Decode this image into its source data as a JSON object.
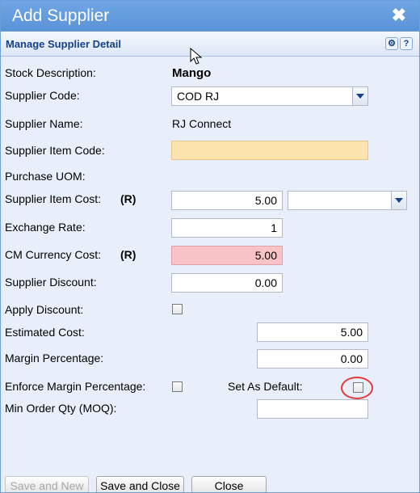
{
  "window": {
    "title": "Add Supplier",
    "close_glyph": "✖"
  },
  "panel": {
    "title": "Manage Supplier Detail",
    "tools": [
      "gear-icon",
      "help-icon"
    ],
    "help_glyph": "?",
    "gear_glyph": "⚙"
  },
  "form": {
    "stock_description": {
      "label": "Stock Description:",
      "value": "Mango"
    },
    "supplier_code": {
      "label": "Supplier Code:",
      "value": "COD RJ"
    },
    "supplier_name": {
      "label": "Supplier Name:",
      "value": "RJ Connect"
    },
    "supplier_item_code": {
      "label": "Supplier Item Code:",
      "value": ""
    },
    "purchase_uom": {
      "label": "Purchase UOM:"
    },
    "supplier_item_cost": {
      "label": "Supplier Item Cost:",
      "marker": "(R)",
      "value": "5.00",
      "currency": ""
    },
    "exchange_rate": {
      "label": "Exchange Rate:",
      "value": "1"
    },
    "cm_currency_cost": {
      "label": "CM Currency Cost:",
      "marker": "(R)",
      "value": "5.00"
    },
    "supplier_discount": {
      "label": "Supplier Discount:",
      "value": "0.00"
    },
    "apply_discount": {
      "label": "Apply Discount:",
      "checked": false
    },
    "estimated_cost": {
      "label": "Estimated Cost:",
      "value": "5.00"
    },
    "margin_percentage": {
      "label": "Margin Percentage:",
      "value": "0.00"
    },
    "enforce_margin": {
      "label": "Enforce Margin Percentage:",
      "checked": false
    },
    "set_as_default": {
      "label": "Set As Default:",
      "checked": false
    },
    "min_order_qty": {
      "label": "Min Order Qty (MOQ):",
      "value": ""
    }
  },
  "buttons": {
    "save_new": "Save and New",
    "save_close": "Save and Close",
    "close": "Close"
  },
  "colors": {
    "title_bar": "#5b93d8",
    "required_yellow": "#fde4ae",
    "required_pink": "#f8c3c6",
    "highlight": "#e0393b"
  }
}
